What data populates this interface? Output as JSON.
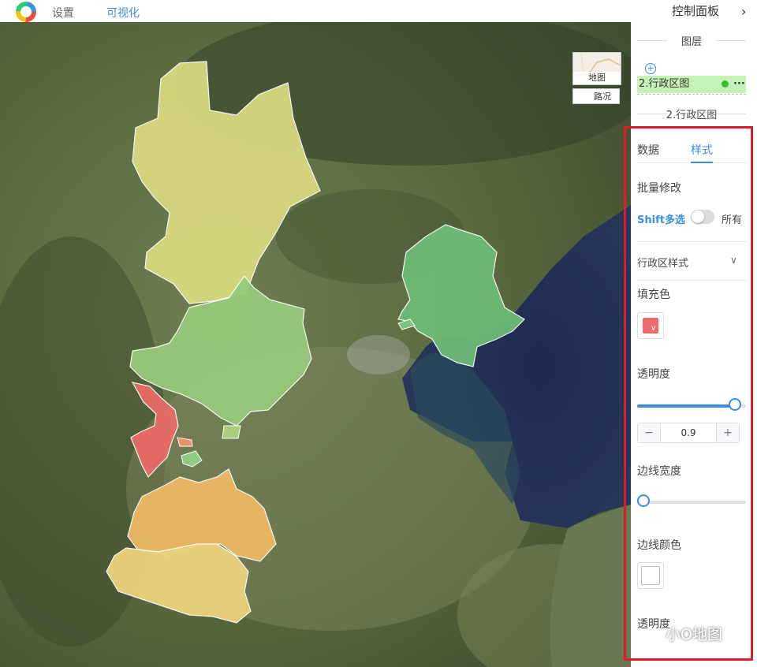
{
  "topbar": {
    "tabs": [
      "设置",
      "可视化"
    ],
    "panel_title": "控制面板",
    "collapse_icon": "chevron-right-icon"
  },
  "basemap": {
    "map_label": "地图",
    "traffic_label": "路况"
  },
  "layers": {
    "section_title": "图层",
    "add_icon": "plus-circle-icon",
    "items": [
      {
        "label": "2.行政区图",
        "visible": true,
        "more": "···"
      }
    ]
  },
  "layer_settings": {
    "title": "2.行政区图",
    "tabs": [
      "数据",
      "样式"
    ],
    "active_tab": "样式",
    "batch_edit_label": "批量修改",
    "shift_label": "Shift多选",
    "all_label": "所有",
    "all_toggle_on": false,
    "region_style_label": "行政区样式",
    "fill_color_label": "填充色",
    "fill_color": "#ef6b6b",
    "opacity_label": "透明度",
    "opacity_value": "0.9",
    "opacity_fraction": 0.9,
    "minus": "−",
    "plus": "+",
    "border_width_label": "边线宽度",
    "border_width_fraction": 0.0,
    "border_color_label": "边线颜色",
    "border_color": "#ffffff",
    "border_opacity_label": "透明度"
  },
  "colors": {
    "accent": "#3a8ee6",
    "highlight_box": "#e21b2c",
    "region_yellow_green": "#d4d77c",
    "region_green": "#94c978",
    "region_green_dark": "#6dbb76",
    "region_red": "#e86b66",
    "region_orange": "#ecb964",
    "region_yellow": "#ecd27c"
  },
  "watermark": {
    "text": "小O地图"
  }
}
